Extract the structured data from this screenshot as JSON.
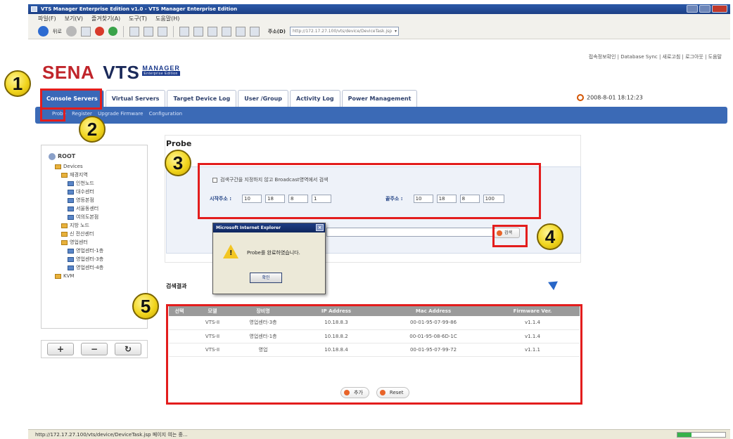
{
  "window": {
    "title": "VTS Manager Enterprise Edition v1.0 - VTS Manager Enterprise Edition"
  },
  "menu": [
    "파일(F)",
    "보기(V)",
    "즐겨찾기(A)",
    "도구(T)",
    "도움말(H)"
  ],
  "toolbar": {
    "back_label": "뒤로",
    "address_label": "주소(D)",
    "address_value": "http://172.17.27.100/vts/device/DeviceTask.jsp"
  },
  "header": {
    "top_links": "접속정보확인 | Database Sync | 새로고침 | 로그아웃 | 도움말",
    "logo_sena": "SENA",
    "logo_vts": "VTS",
    "logo_manager": "MANAGER",
    "logo_edition": "Enterprise Edition",
    "datetime": "2008-8-01 18:12:23"
  },
  "tabs": [
    {
      "label": "Console Servers",
      "active": true
    },
    {
      "label": "Virtual Servers",
      "active": false
    },
    {
      "label": "Target Device Log",
      "active": false
    },
    {
      "label": "User /Group",
      "active": false
    },
    {
      "label": "Activity Log",
      "active": false
    },
    {
      "label": "Power Management",
      "active": false
    }
  ],
  "subnav": [
    "Probe",
    "Register",
    "Upgrade Firmware",
    "Configuration"
  ],
  "tree": {
    "root": "ROOT",
    "items": [
      {
        "label": "Devices",
        "type": "folder",
        "depth": 1
      },
      {
        "label": "재경지역",
        "type": "folder",
        "depth": 2
      },
      {
        "label": "인천노드",
        "type": "pc",
        "depth": 3
      },
      {
        "label": "대수센터",
        "type": "pc",
        "depth": 3
      },
      {
        "label": "영등본점",
        "type": "pc",
        "depth": 3
      },
      {
        "label": "서울동센터",
        "type": "pc",
        "depth": 3
      },
      {
        "label": "여의도본점",
        "type": "pc",
        "depth": 3
      },
      {
        "label": "지방 노드",
        "type": "folder",
        "depth": 2
      },
      {
        "label": "신 전산센터",
        "type": "folder",
        "depth": 2
      },
      {
        "label": "영업센터",
        "type": "folder",
        "depth": 2
      },
      {
        "label": "영업센터-1층",
        "type": "pc",
        "depth": 3
      },
      {
        "label": "영업센터-3층",
        "type": "pc",
        "depth": 3
      },
      {
        "label": "영업센터-4층",
        "type": "pc",
        "depth": 3
      },
      {
        "label": "KVM",
        "type": "folder",
        "depth": 1
      }
    ],
    "buttons": {
      "add": "+",
      "remove": "−",
      "refresh": "↻"
    }
  },
  "probe": {
    "title": "Probe",
    "checkbox_label": "검색구간을 지정하지 않고 Broadcast영역에서 검색",
    "start_label": "시작주소 :",
    "start_ip": [
      "10",
      "18",
      "8",
      "1"
    ],
    "end_label": "끝주소 :",
    "end_ip": [
      "10",
      "18",
      "8",
      "100"
    ],
    "search_button": "검색"
  },
  "dialog": {
    "title": "Microsoft Internet Explorer",
    "message": "Probe를 완료하였습니다.",
    "ok": "확인",
    "close": "×"
  },
  "results": {
    "title": "검색결과",
    "columns": [
      "선택",
      "모델",
      "장비명",
      "IP Address",
      "Mac Address",
      "Firmware Ver."
    ],
    "rows": [
      [
        "",
        "VTS-II",
        "영업센터-3층",
        "10.18.8.3",
        "00-01-95-07-99-86",
        "v1.1.4"
      ],
      [
        "",
        "VTS-II",
        "영업센터-1층",
        "10.18.8.2",
        "00-01-95-08-6D-1C",
        "v1.1.4"
      ],
      [
        "",
        "VTS-II",
        "영업",
        "10.18.8.4",
        "00-01-95-07-99-72",
        "v1.1.1"
      ]
    ],
    "add_button": "추가",
    "reset_button": "Reset"
  },
  "callouts": [
    "1",
    "2",
    "3",
    "4",
    "5"
  ],
  "status": {
    "text": "http://172.17.27.100/vts/device/DeviceTask.jsp 페이지 여는 중...",
    "progress": 0.3
  },
  "colors": {
    "accent": "#3b6ab6",
    "highlight": "#e31d1d",
    "badge": "#f1d51e"
  }
}
